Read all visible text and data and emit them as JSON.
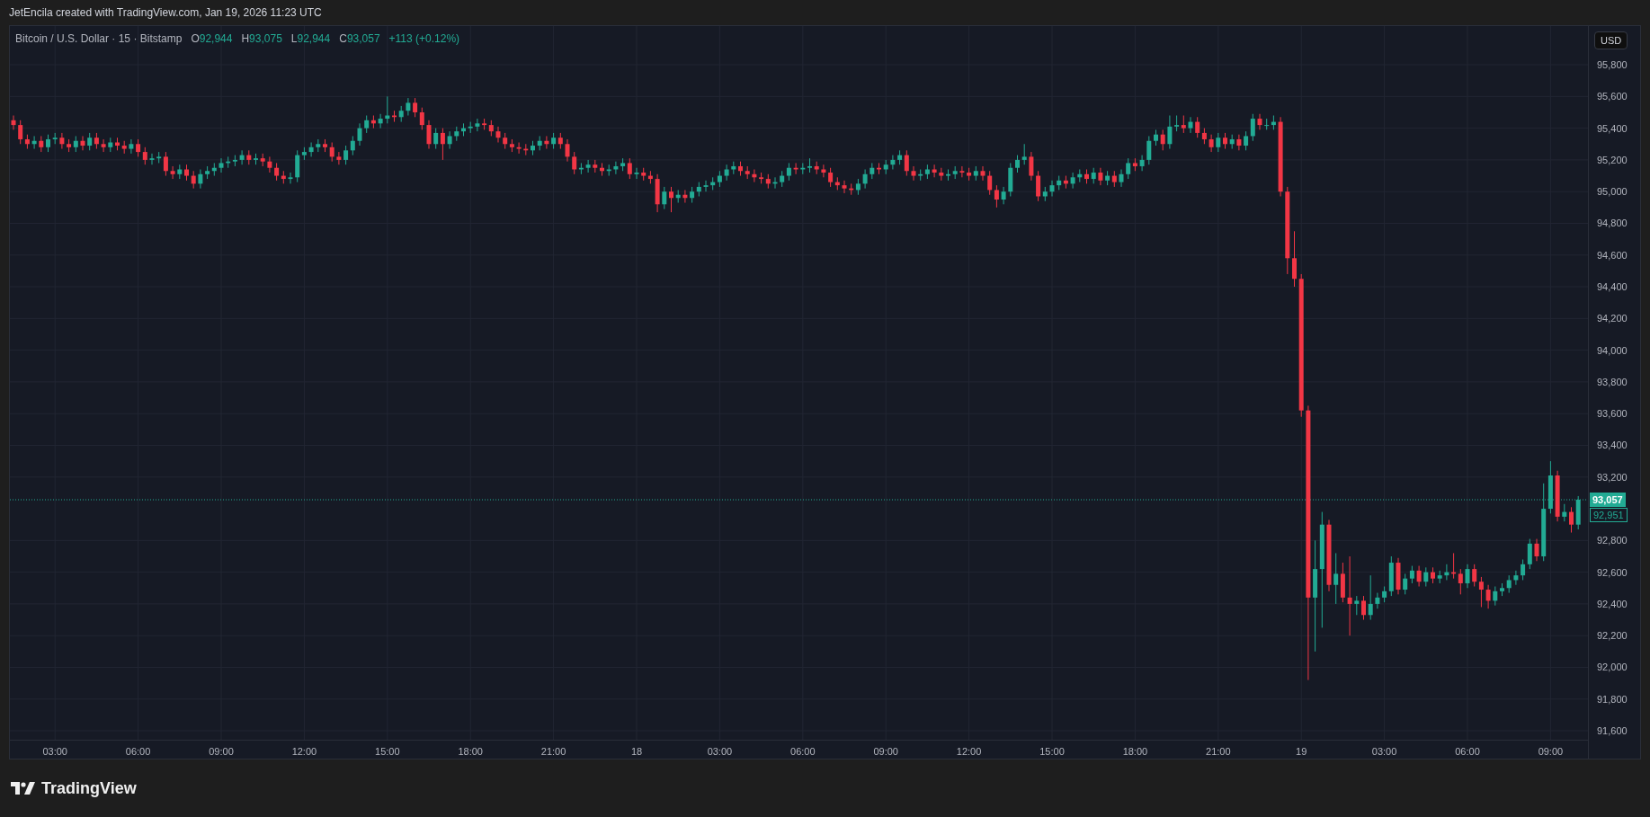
{
  "caption": "JetEncila created with TradingView.com, Jan 19, 2026 11:23 UTC",
  "legend": {
    "symbol": "Bitcoin / U.S. Dollar · 15 · Bitstamp",
    "fields": [
      {
        "label": "O",
        "value": "92,944"
      },
      {
        "label": "H",
        "value": "93,075"
      },
      {
        "label": "L",
        "value": "92,944"
      },
      {
        "label": "C",
        "value": "93,057"
      }
    ],
    "change": "+113 (+0.12%)"
  },
  "currency_button": "USD",
  "chart": {
    "chart_data": {
      "type": "candlestick",
      "ylim": [
        91538,
        96044
      ],
      "grid": true,
      "ref_lines": [
        {
          "axis": "y",
          "value": 93057,
          "color": "#22ab94"
        }
      ],
      "yticks": [
        {
          "value": 91600,
          "label": "91,600"
        },
        {
          "value": 91800,
          "label": "91,800"
        },
        {
          "value": 92000,
          "label": "92,000"
        },
        {
          "value": 92200,
          "label": "92,200"
        },
        {
          "value": 92400,
          "label": "92,400"
        },
        {
          "value": 92600,
          "label": "92,600"
        },
        {
          "value": 92800,
          "label": "92,800"
        },
        {
          "value": 93200,
          "label": "93,200"
        },
        {
          "value": 93400,
          "label": "93,400"
        },
        {
          "value": 93600,
          "label": "93,600"
        },
        {
          "value": 93800,
          "label": "93,800"
        },
        {
          "value": 94000,
          "label": "94,000"
        },
        {
          "value": 94200,
          "label": "94,200"
        },
        {
          "value": 94400,
          "label": "94,400"
        },
        {
          "value": 94600,
          "label": "94,600"
        },
        {
          "value": 94800,
          "label": "94,800"
        },
        {
          "value": 95000,
          "label": "95,000"
        },
        {
          "value": 95200,
          "label": "95,200"
        },
        {
          "value": 95400,
          "label": "95,400"
        },
        {
          "value": 95600,
          "label": "95,600"
        },
        {
          "value": 95800,
          "label": "95,800"
        }
      ],
      "categories": [
        null,
        null,
        null,
        null,
        null,
        null,
        "03:00",
        null,
        null,
        null,
        null,
        null,
        null,
        null,
        null,
        null,
        null,
        null,
        "06:00",
        null,
        null,
        null,
        null,
        null,
        null,
        null,
        null,
        null,
        null,
        null,
        "09:00",
        null,
        null,
        null,
        null,
        null,
        null,
        null,
        null,
        null,
        null,
        null,
        "12:00",
        null,
        null,
        null,
        null,
        null,
        null,
        null,
        null,
        null,
        null,
        null,
        "15:00",
        null,
        null,
        null,
        null,
        null,
        null,
        null,
        null,
        null,
        null,
        null,
        "18:00",
        null,
        null,
        null,
        null,
        null,
        null,
        null,
        null,
        null,
        null,
        null,
        "21:00",
        null,
        null,
        null,
        null,
        null,
        null,
        null,
        null,
        null,
        null,
        null,
        "18",
        null,
        null,
        null,
        null,
        null,
        null,
        null,
        null,
        null,
        null,
        null,
        "03:00",
        null,
        null,
        null,
        null,
        null,
        null,
        null,
        null,
        null,
        null,
        null,
        "06:00",
        null,
        null,
        null,
        null,
        null,
        null,
        null,
        null,
        null,
        null,
        null,
        "09:00",
        null,
        null,
        null,
        null,
        null,
        null,
        null,
        null,
        null,
        null,
        null,
        "12:00",
        null,
        null,
        null,
        null,
        null,
        null,
        null,
        null,
        null,
        null,
        null,
        "15:00",
        null,
        null,
        null,
        null,
        null,
        null,
        null,
        null,
        null,
        null,
        null,
        "18:00",
        null,
        null,
        null,
        null,
        null,
        null,
        null,
        null,
        null,
        null,
        null,
        "21:00",
        null,
        null,
        null,
        null,
        null,
        null,
        null,
        null,
        null,
        null,
        null,
        "19",
        null,
        null,
        null,
        null,
        null,
        null,
        null,
        null,
        null,
        null,
        null,
        "03:00",
        null,
        null,
        null,
        null,
        null,
        null,
        null,
        null,
        null,
        null,
        null,
        "06:00",
        null,
        null,
        null,
        null,
        null,
        null,
        null,
        null,
        null,
        null,
        null,
        "09:00",
        null,
        null,
        null,
        null
      ],
      "ohlc": [
        [
          95450,
          95480,
          95390,
          95420
        ],
        [
          95420,
          95450,
          95300,
          95330
        ],
        [
          95330,
          95360,
          95270,
          95300
        ],
        [
          95300,
          95350,
          95270,
          95320
        ],
        [
          95320,
          95350,
          95250,
          95280
        ],
        [
          95280,
          95360,
          95250,
          95330
        ],
        [
          95330,
          95370,
          95300,
          95340
        ],
        [
          95340,
          95370,
          95270,
          95300
        ],
        [
          95300,
          95330,
          95250,
          95280
        ],
        [
          95280,
          95350,
          95250,
          95320
        ],
        [
          95320,
          95350,
          95260,
          95290
        ],
        [
          95290,
          95370,
          95260,
          95340
        ],
        [
          95340,
          95370,
          95270,
          95300
        ],
        [
          95300,
          95330,
          95250,
          95280
        ],
        [
          95280,
          95340,
          95250,
          95310
        ],
        [
          95310,
          95340,
          95260,
          95290
        ],
        [
          95290,
          95320,
          95240,
          95270
        ],
        [
          95270,
          95330,
          95240,
          95300
        ],
        [
          95300,
          95330,
          95220,
          95250
        ],
        [
          95250,
          95280,
          95170,
          95200
        ],
        [
          95200,
          95240,
          95170,
          95210
        ],
        [
          95210,
          95250,
          95180,
          95220
        ],
        [
          95220,
          95250,
          95100,
          95130
        ],
        [
          95130,
          95160,
          95080,
          95110
        ],
        [
          95110,
          95170,
          95080,
          95140
        ],
        [
          95140,
          95170,
          95070,
          95100
        ],
        [
          95100,
          95130,
          95020,
          95050
        ],
        [
          95050,
          95140,
          95020,
          95110
        ],
        [
          95110,
          95160,
          95080,
          95130
        ],
        [
          95130,
          95180,
          95100,
          95150
        ],
        [
          95150,
          95210,
          95120,
          95180
        ],
        [
          95180,
          95220,
          95150,
          95190
        ],
        [
          95190,
          95230,
          95160,
          95200
        ],
        [
          95200,
          95260,
          95170,
          95230
        ],
        [
          95230,
          95260,
          95170,
          95200
        ],
        [
          95200,
          95240,
          95170,
          95210
        ],
        [
          95210,
          95240,
          95160,
          95190
        ],
        [
          95190,
          95220,
          95120,
          95150
        ],
        [
          95150,
          95180,
          95070,
          95100
        ],
        [
          95100,
          95130,
          95050,
          95080
        ],
        [
          95080,
          95120,
          95050,
          95090
        ],
        [
          95090,
          95260,
          95060,
          95230
        ],
        [
          95230,
          95280,
          95200,
          95250
        ],
        [
          95250,
          95310,
          95220,
          95280
        ],
        [
          95280,
          95330,
          95250,
          95300
        ],
        [
          95300,
          95330,
          95250,
          95280
        ],
        [
          95280,
          95310,
          95190,
          95220
        ],
        [
          95220,
          95250,
          95170,
          95200
        ],
        [
          95200,
          95290,
          95170,
          95260
        ],
        [
          95260,
          95350,
          95230,
          95320
        ],
        [
          95320,
          95430,
          95290,
          95400
        ],
        [
          95400,
          95480,
          95370,
          95450
        ],
        [
          95450,
          95480,
          95400,
          95430
        ],
        [
          95430,
          95490,
          95400,
          95460
        ],
        [
          95460,
          95600,
          95430,
          95480
        ],
        [
          95480,
          95510,
          95440,
          95470
        ],
        [
          95470,
          95540,
          95440,
          95510
        ],
        [
          95510,
          95590,
          95480,
          95560
        ],
        [
          95560,
          95590,
          95470,
          95500
        ],
        [
          95500,
          95530,
          95390,
          95420
        ],
        [
          95420,
          95450,
          95270,
          95300
        ],
        [
          95300,
          95400,
          95270,
          95370
        ],
        [
          95370,
          95400,
          95200,
          95300
        ],
        [
          95300,
          95380,
          95270,
          95350
        ],
        [
          95350,
          95410,
          95320,
          95380
        ],
        [
          95380,
          95430,
          95350,
          95400
        ],
        [
          95400,
          95440,
          95370,
          95410
        ],
        [
          95410,
          95460,
          95380,
          95430
        ],
        [
          95430,
          95460,
          95390,
          95420
        ],
        [
          95420,
          95450,
          95350,
          95380
        ],
        [
          95380,
          95410,
          95310,
          95340
        ],
        [
          95340,
          95370,
          95270,
          95300
        ],
        [
          95300,
          95330,
          95250,
          95280
        ],
        [
          95280,
          95310,
          95240,
          95270
        ],
        [
          95270,
          95300,
          95230,
          95260
        ],
        [
          95260,
          95320,
          95230,
          95290
        ],
        [
          95290,
          95350,
          95260,
          95320
        ],
        [
          95320,
          95350,
          95270,
          95300
        ],
        [
          95300,
          95370,
          95270,
          95340
        ],
        [
          95340,
          95370,
          95270,
          95300
        ],
        [
          95300,
          95330,
          95190,
          95220
        ],
        [
          95220,
          95250,
          95110,
          95140
        ],
        [
          95140,
          95180,
          95110,
          95150
        ],
        [
          95150,
          95200,
          95120,
          95170
        ],
        [
          95170,
          95200,
          95120,
          95150
        ],
        [
          95150,
          95180,
          95100,
          95130
        ],
        [
          95130,
          95170,
          95100,
          95140
        ],
        [
          95140,
          95190,
          95110,
          95160
        ],
        [
          95160,
          95210,
          95130,
          95180
        ],
        [
          95180,
          95210,
          95080,
          95110
        ],
        [
          95110,
          95150,
          95080,
          95120
        ],
        [
          95120,
          95150,
          95070,
          95100
        ],
        [
          95100,
          95130,
          95050,
          95080
        ],
        [
          95080,
          95110,
          94870,
          94920
        ],
        [
          94920,
          95030,
          94890,
          95000
        ],
        [
          95000,
          95030,
          94870,
          94960
        ],
        [
          94960,
          95010,
          94930,
          94980
        ],
        [
          94980,
          95010,
          94930,
          94960
        ],
        [
          94960,
          95030,
          94930,
          95000
        ],
        [
          95000,
          95060,
          94970,
          95030
        ],
        [
          95030,
          95070,
          95000,
          95040
        ],
        [
          95040,
          95090,
          95010,
          95060
        ],
        [
          95060,
          95130,
          95030,
          95100
        ],
        [
          95100,
          95170,
          95070,
          95140
        ],
        [
          95140,
          95190,
          95110,
          95160
        ],
        [
          95160,
          95190,
          95100,
          95130
        ],
        [
          95130,
          95160,
          95080,
          95110
        ],
        [
          95110,
          95140,
          95060,
          95090
        ],
        [
          95090,
          95120,
          95050,
          95080
        ],
        [
          95080,
          95110,
          95020,
          95050
        ],
        [
          95050,
          95090,
          95020,
          95060
        ],
        [
          95060,
          95130,
          95030,
          95100
        ],
        [
          95100,
          95180,
          95070,
          95150
        ],
        [
          95150,
          95180,
          95110,
          95140
        ],
        [
          95140,
          95180,
          95110,
          95150
        ],
        [
          95150,
          95210,
          95120,
          95160
        ],
        [
          95160,
          95190,
          95110,
          95140
        ],
        [
          95140,
          95170,
          95090,
          95120
        ],
        [
          95120,
          95150,
          95030,
          95060
        ],
        [
          95060,
          95090,
          95010,
          95040
        ],
        [
          95040,
          95070,
          94990,
          95020
        ],
        [
          95020,
          95050,
          94980,
          95010
        ],
        [
          95010,
          95080,
          94980,
          95050
        ],
        [
          95050,
          95140,
          95020,
          95110
        ],
        [
          95110,
          95180,
          95080,
          95150
        ],
        [
          95150,
          95180,
          95110,
          95140
        ],
        [
          95140,
          95200,
          95110,
          95170
        ],
        [
          95170,
          95230,
          95140,
          95200
        ],
        [
          95200,
          95260,
          95170,
          95230
        ],
        [
          95230,
          95260,
          95100,
          95130
        ],
        [
          95130,
          95160,
          95070,
          95100
        ],
        [
          95100,
          95140,
          95070,
          95110
        ],
        [
          95110,
          95170,
          95080,
          95140
        ],
        [
          95140,
          95170,
          95090,
          95120
        ],
        [
          95120,
          95150,
          95070,
          95100
        ],
        [
          95100,
          95140,
          95070,
          95110
        ],
        [
          95110,
          95160,
          95080,
          95130
        ],
        [
          95130,
          95160,
          95090,
          95120
        ],
        [
          95120,
          95150,
          95070,
          95100
        ],
        [
          95100,
          95160,
          95070,
          95130
        ],
        [
          95130,
          95160,
          95070,
          95100
        ],
        [
          95100,
          95130,
          94980,
          95010
        ],
        [
          95010,
          95040,
          94900,
          94950
        ],
        [
          94950,
          95030,
          94920,
          95000
        ],
        [
          95000,
          95180,
          94970,
          95150
        ],
        [
          95150,
          95230,
          95120,
          95200
        ],
        [
          95200,
          95300,
          95170,
          95220
        ],
        [
          95220,
          95250,
          95070,
          95100
        ],
        [
          95100,
          95130,
          94940,
          94970
        ],
        [
          94970,
          95030,
          94940,
          95000
        ],
        [
          95000,
          95070,
          94970,
          95040
        ],
        [
          95040,
          95100,
          95010,
          95070
        ],
        [
          95070,
          95100,
          95020,
          95050
        ],
        [
          95050,
          95120,
          95020,
          95090
        ],
        [
          95090,
          95140,
          95060,
          95110
        ],
        [
          95110,
          95140,
          95050,
          95080
        ],
        [
          95080,
          95150,
          95050,
          95120
        ],
        [
          95120,
          95150,
          95040,
          95070
        ],
        [
          95070,
          95130,
          95040,
          95100
        ],
        [
          95100,
          95130,
          95030,
          95060
        ],
        [
          95060,
          95140,
          95030,
          95110
        ],
        [
          95110,
          95210,
          95080,
          95180
        ],
        [
          95180,
          95210,
          95130,
          95160
        ],
        [
          95160,
          95230,
          95130,
          95200
        ],
        [
          95200,
          95350,
          95170,
          95320
        ],
        [
          95320,
          95390,
          95290,
          95360
        ],
        [
          95360,
          95390,
          95260,
          95300
        ],
        [
          95300,
          95480,
          95270,
          95410
        ],
        [
          95410,
          95480,
          95380,
          95420
        ],
        [
          95420,
          95480,
          95370,
          95400
        ],
        [
          95400,
          95470,
          95370,
          95440
        ],
        [
          95440,
          95470,
          95340,
          95370
        ],
        [
          95370,
          95400,
          95300,
          95330
        ],
        [
          95330,
          95360,
          95250,
          95280
        ],
        [
          95280,
          95370,
          95250,
          95340
        ],
        [
          95340,
          95370,
          95270,
          95300
        ],
        [
          95300,
          95360,
          95270,
          95330
        ],
        [
          95330,
          95360,
          95260,
          95290
        ],
        [
          95290,
          95380,
          95260,
          95350
        ],
        [
          95350,
          95490,
          95320,
          95460
        ],
        [
          95460,
          95490,
          95390,
          95420
        ],
        [
          95420,
          95460,
          95390,
          95420
        ],
        [
          95420,
          95480,
          95390,
          95440
        ],
        [
          95440,
          95470,
          94970,
          95000
        ],
        [
          95000,
          95030,
          94480,
          94580
        ],
        [
          94580,
          94750,
          94400,
          94450
        ],
        [
          94450,
          94480,
          93580,
          93620
        ],
        [
          93620,
          93650,
          91920,
          92440
        ],
        [
          92440,
          92800,
          92100,
          92620
        ],
        [
          92620,
          92980,
          92250,
          92900
        ],
        [
          92900,
          92930,
          92480,
          92520
        ],
        [
          92520,
          92720,
          92400,
          92590
        ],
        [
          92590,
          92660,
          92410,
          92440
        ],
        [
          92440,
          92700,
          92200,
          92400
        ],
        [
          92400,
          92450,
          92330,
          92420
        ],
        [
          92420,
          92450,
          92300,
          92330
        ],
        [
          92330,
          92580,
          92300,
          92400
        ],
        [
          92400,
          92470,
          92370,
          92440
        ],
        [
          92440,
          92510,
          92410,
          92480
        ],
        [
          92480,
          92700,
          92450,
          92660
        ],
        [
          92660,
          92690,
          92460,
          92490
        ],
        [
          92490,
          92590,
          92460,
          92560
        ],
        [
          92560,
          92640,
          92530,
          92610
        ],
        [
          92610,
          92640,
          92510,
          92540
        ],
        [
          92540,
          92630,
          92510,
          92600
        ],
        [
          92600,
          92630,
          92530,
          92560
        ],
        [
          92560,
          92610,
          92530,
          92580
        ],
        [
          92580,
          92650,
          92550,
          92600
        ],
        [
          92600,
          92720,
          92560,
          92590
        ],
        [
          92590,
          92620,
          92460,
          92530
        ],
        [
          92530,
          92650,
          92500,
          92620
        ],
        [
          92620,
          92650,
          92510,
          92540
        ],
        [
          92540,
          92570,
          92380,
          92490
        ],
        [
          92490,
          92520,
          92370,
          92420
        ],
        [
          92420,
          92510,
          92390,
          92480
        ],
        [
          92480,
          92530,
          92450,
          92500
        ],
        [
          92500,
          92580,
          92470,
          92550
        ],
        [
          92550,
          92610,
          92520,
          92580
        ],
        [
          92580,
          92680,
          92550,
          92650
        ],
        [
          92650,
          92810,
          92620,
          92780
        ],
        [
          92780,
          92810,
          92670,
          92700
        ],
        [
          92700,
          93160,
          92670,
          93000
        ],
        [
          93000,
          93300,
          92970,
          93210
        ],
        [
          93210,
          93240,
          92920,
          92950
        ],
        [
          92950,
          93030,
          92920,
          92980
        ],
        [
          92980,
          93010,
          92850,
          92900
        ],
        [
          92900,
          93080,
          92870,
          93057
        ]
      ]
    },
    "last_price": "93,057",
    "close_label": "92,951"
  },
  "logo": "TradingView"
}
